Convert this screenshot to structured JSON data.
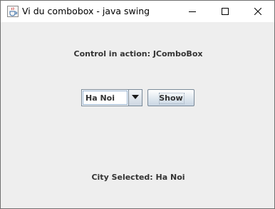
{
  "window": {
    "title": "Vi du combobox - java swing",
    "icons": {
      "app": "java-cup-icon",
      "minimize": "minimize-icon",
      "maximize": "maximize-icon",
      "close": "close-icon"
    }
  },
  "main": {
    "heading": "Control in action: JComboBox",
    "combo": {
      "selected": "Ha Noi",
      "arrow_icon": "chevron-down-icon"
    },
    "show_button_label": "Show",
    "status_text": "City Selected: Ha Noi"
  },
  "colors": {
    "background": "#eeeeee",
    "titlebar": "#ffffff",
    "text": "#333333",
    "border": "#7a8a99"
  }
}
